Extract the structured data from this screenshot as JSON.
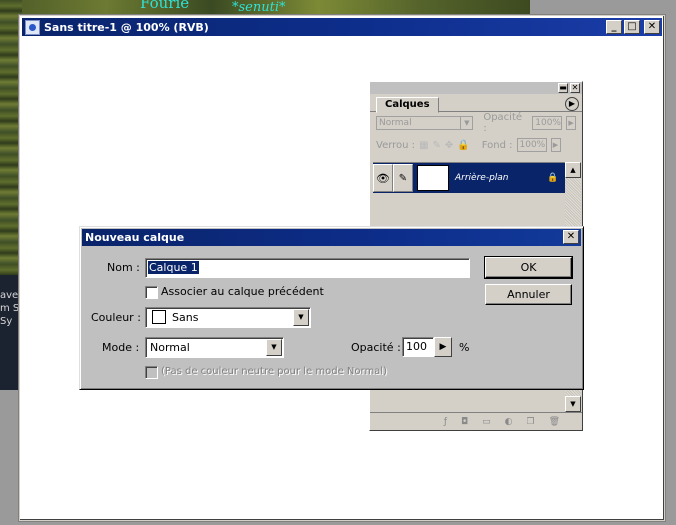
{
  "background": {
    "art_title": "Fourie",
    "art_subtitle": "*senuti*",
    "snippets": [
      "ave",
      "m S",
      "Sy"
    ]
  },
  "document_window": {
    "title": "Sans titre-1 @ 100% (RVB)",
    "minimize_glyph": "_",
    "maximize_glyph": "□",
    "close_glyph": "✕"
  },
  "layers_palette": {
    "tab_label": "Calques",
    "blend_mode": "Normal",
    "opacity_label": "Opacité :",
    "opacity_value": "100%",
    "lock_label": "Verrou :",
    "fill_label": "Fond :",
    "fill_value": "100%",
    "layer_name": "Arrière-plan",
    "menu_glyph": "▶"
  },
  "dialog": {
    "title": "Nouveau calque",
    "name_label": "Nom :",
    "name_value": "Calque 1",
    "group_checkbox_label": "Associer au calque précédent",
    "color_label": "Couleur :",
    "color_value": "Sans",
    "mode_label": "Mode :",
    "mode_value": "Normal",
    "opacity_label": "Opacité :",
    "opacity_value": "100",
    "percent_sign": "%",
    "neutral_checkbox_label": "(Pas de couleur neutre pour le mode Normal)",
    "ok_label": "OK",
    "cancel_label": "Annuler",
    "close_glyph": "✕"
  },
  "colors": {
    "title_bar": "#0a246a",
    "face": "#c0c0c0",
    "selection": "#0a246a"
  }
}
